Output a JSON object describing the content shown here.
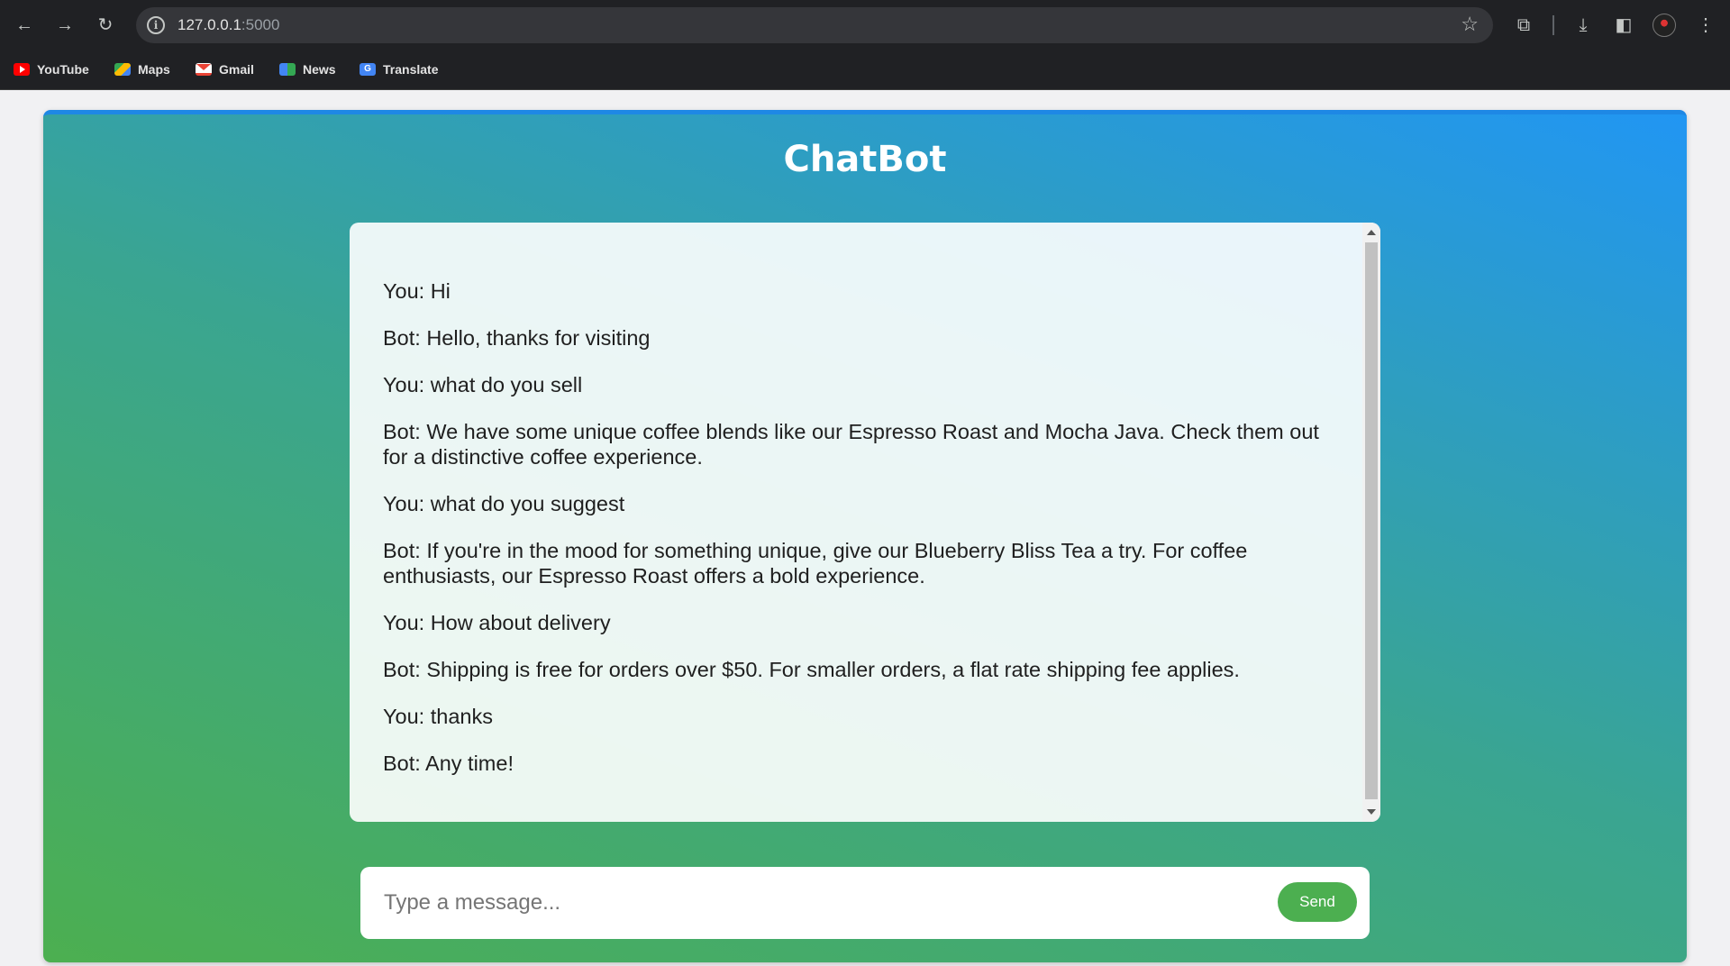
{
  "browser": {
    "url_host": "127.0.0.1",
    "url_port": ":5000",
    "bookmarks": [
      {
        "label": "YouTube",
        "icon": "youtube-icon"
      },
      {
        "label": "Maps",
        "icon": "maps-icon"
      },
      {
        "label": "Gmail",
        "icon": "gmail-icon"
      },
      {
        "label": "News",
        "icon": "news-icon"
      },
      {
        "label": "Translate",
        "icon": "translate-icon"
      }
    ]
  },
  "app": {
    "title": "ChatBot",
    "accent": "#4caf50",
    "messages": [
      "You: Hi",
      "Bot: Hello, thanks for visiting",
      "You: what do you sell",
      "Bot: We have some unique coffee blends like our Espresso Roast and Mocha Java. Check them out for a distinctive coffee experience.",
      "You: what do you suggest",
      "Bot: If you're in the mood for something unique, give our Blueberry Bliss Tea a try. For coffee enthusiasts, our Espresso Roast offers a bold experience.",
      "You: How about delivery",
      "Bot: Shipping is free for orders over $50. For smaller orders, a flat rate shipping fee applies.",
      "You: thanks",
      "Bot: Any time!"
    ],
    "input": {
      "placeholder": "Type a message...",
      "value": ""
    },
    "send_label": "Send"
  }
}
